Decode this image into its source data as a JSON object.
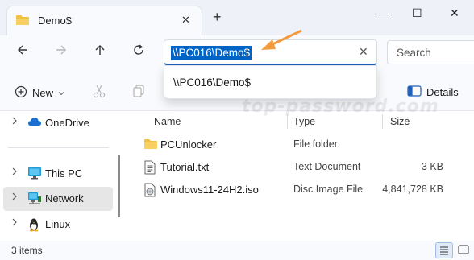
{
  "window": {
    "tab_title": "Demo$",
    "minimize_glyph": "—",
    "maximize_glyph": "☐",
    "close_glyph": "✕",
    "new_tab_glyph": "+"
  },
  "nav": {
    "back_icon": "arrow-left-icon",
    "forward_icon": "arrow-right-icon",
    "up_icon": "arrow-up-icon",
    "refresh_icon": "refresh-icon",
    "address_value": "\\\\PC016\\Demo$",
    "search_placeholder": "Search"
  },
  "address_suggestions": [
    "\\\\PC016\\Demo$"
  ],
  "toolbar": {
    "new_label": "New",
    "details_label": "Details"
  },
  "sidebar": {
    "items": [
      {
        "label": "OneDrive",
        "icon": "cloud-icon"
      },
      {
        "label": "This PC",
        "icon": "monitor-icon"
      },
      {
        "label": "Network",
        "icon": "network-icon",
        "selected": true
      },
      {
        "label": "Linux",
        "icon": "linux-penguin-icon"
      }
    ]
  },
  "columns": {
    "name": "Name",
    "type": "Type",
    "size": "Size"
  },
  "files": [
    {
      "name": "PCUnlocker",
      "type": "File folder",
      "size": "",
      "icon": "folder-icon"
    },
    {
      "name": "Tutorial.txt",
      "type": "Text Document",
      "size": "3 KB",
      "icon": "text-file-icon"
    },
    {
      "name": "Windows11-24H2.iso",
      "type": "Disc Image File",
      "size": "4,841,728 KB",
      "icon": "disc-image-icon"
    }
  ],
  "status": {
    "item_count": "3 items"
  },
  "watermark": "top-password.com",
  "colors": {
    "accent": "#0063c6",
    "folder": "#f3c043",
    "arrow": "#f39a3d"
  }
}
